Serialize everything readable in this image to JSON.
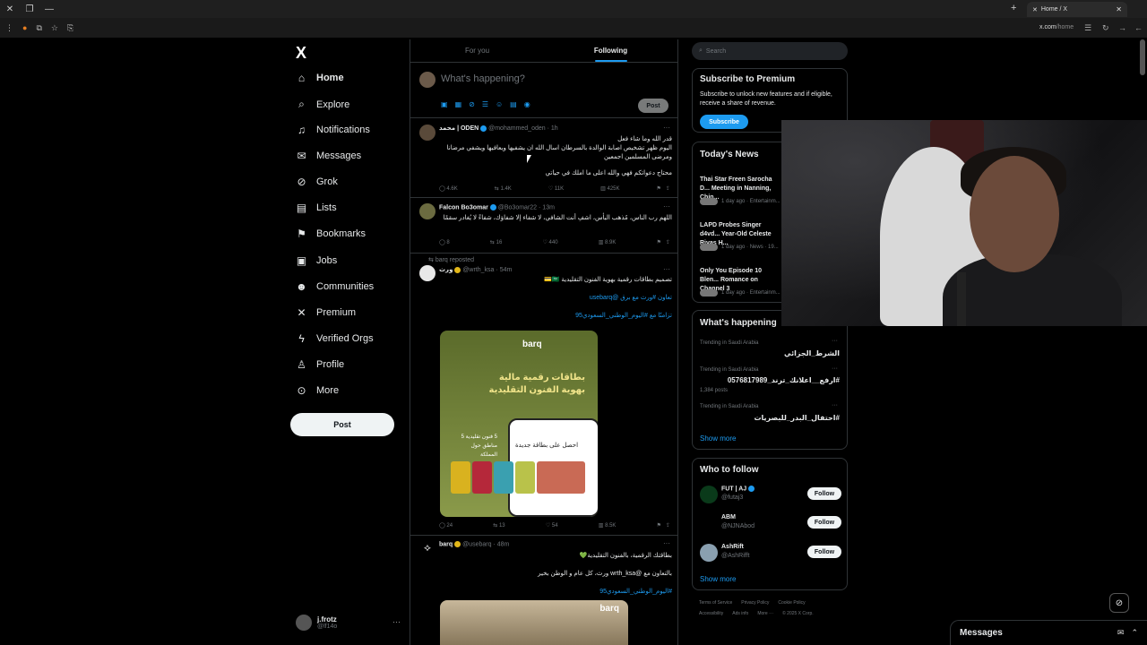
{
  "browser": {
    "tab_title": "Home / X",
    "url_domain": "x.com",
    "url_path": "/home"
  },
  "nav": {
    "logo": "X",
    "items": [
      {
        "label": "Home",
        "icon": "home-icon",
        "glyph": "⌂"
      },
      {
        "label": "Explore",
        "icon": "search-icon",
        "glyph": "⌕"
      },
      {
        "label": "Notifications",
        "icon": "bell-icon",
        "glyph": "♫"
      },
      {
        "label": "Messages",
        "icon": "mail-icon",
        "glyph": "✉"
      },
      {
        "label": "Grok",
        "icon": "grok-icon",
        "glyph": "⊘"
      },
      {
        "label": "Lists",
        "icon": "list-icon",
        "glyph": "▤"
      },
      {
        "label": "Bookmarks",
        "icon": "bookmark-icon",
        "glyph": "⚑"
      },
      {
        "label": "Jobs",
        "icon": "briefcase-icon",
        "glyph": "▣"
      },
      {
        "label": "Communities",
        "icon": "people-icon",
        "glyph": "☻"
      },
      {
        "label": "Premium",
        "icon": "x-premium-icon",
        "glyph": "✕"
      },
      {
        "label": "Verified Orgs",
        "icon": "lightning-icon",
        "glyph": "ϟ"
      },
      {
        "label": "Profile",
        "icon": "person-icon",
        "glyph": "♙"
      },
      {
        "label": "More",
        "icon": "more-circle-icon",
        "glyph": "⊙"
      }
    ],
    "post_label": "Post",
    "user_name": "j.frotz",
    "user_handle": "@lf14o"
  },
  "feed": {
    "tabs": [
      "For you",
      "Following"
    ],
    "compose_placeholder": "What's happening?",
    "compose_post": "Post",
    "tweets": [
      {
        "name": "محمد | ODEN",
        "handle": "@mohammed_oden",
        "time": "1h",
        "lines": [
          "قدر الله وما شاء فعل",
          "اليوم ظهر تشخيص اصابة الوالدة بالسرطان اسال الله ان يشفيها ويعافيها ويشفي مرضانا ومرضى المسلمين اجمعين",
          "محتاج دعواتكم فهي والله اعلى ما املك في حياتي"
        ],
        "replies": "4.6K",
        "reposts": "1.4K",
        "likes": "11K",
        "views": "425K"
      },
      {
        "name": "Falcon Bo3omar",
        "handle": "@Bo3omar22",
        "time": "13m",
        "lines": [
          "اللهم رب الناس، مُذهب البأس، اشفِ أنت الشافي، لا شفاء إلا شفاؤك، شفاءً لا يُغادر سقمًا"
        ],
        "replies": "8",
        "reposts": "16",
        "likes": "440",
        "views": "8.9K"
      },
      {
        "reposted_by": "barq reposted",
        "name": "ورث",
        "handle": "@wrth_ksa",
        "time": "54m",
        "lines": [
          "تصميم بطاقات رقمية بهوية الفنون التقليدية 🇸🇦💳",
          "تعاون #ورث مع برق @usebarq",
          "تزامنًا مع #اليوم_الوطني_السعودي95"
        ],
        "card_brand": "barq",
        "card_title": "بطاقات رقمية مالية بهوية الفنون التقليدية",
        "card_phone": "احصل على بطاقة جديدة",
        "card_side": "5 فنون تقليدية 5 مناطق حول المملكة",
        "replies": "24",
        "reposts": "13",
        "likes": "54",
        "views": "8.5K"
      },
      {
        "name": "barq",
        "handle": "@usebarq",
        "time": "48m",
        "lines": [
          "بطاقتك الرقمية، بالفنون التقليدية💚",
          "بالتعاون مع @wrth_ksa ورث، كل عام و الوطن بخير",
          "#اليوم_الوطني_السعودي95"
        ],
        "card_brand": "barq"
      }
    ]
  },
  "sidebar": {
    "search_placeholder": "Search",
    "premium_title": "Subscribe to Premium",
    "premium_text": "Subscribe to unlock new features and if eligible, receive a share of revenue.",
    "premium_button": "Subscribe",
    "news_title": "Today's News",
    "news": [
      {
        "title": "Thai Star Freen Sarocha D... Meeting in Nanning, Chin...",
        "meta": "1 day ago · Entertainm..."
      },
      {
        "title": "LAPD Probes Singer d4vd... Year-Old Celeste Rivas H...",
        "meta": "1 day ago · News · 19..."
      },
      {
        "title": "Only You Episode 10 Blen... Romance on Channel 3",
        "meta": "1 day ago · Entertainm..."
      }
    ],
    "trending_title": "What's happening",
    "trends": [
      {
        "category": "Trending in Saudi Arabia",
        "name": "الشرط_الجزائي",
        "posts": ""
      },
      {
        "category": "Trending in Saudi Arabia",
        "name": "#ارفع__اعلانك_ترند_0576817989",
        "posts": "1,384 posts"
      },
      {
        "category": "Trending in Saudi Arabia",
        "name": "#احتفال_البدر_للبصريات",
        "posts": ""
      }
    ],
    "show_more": "Show more",
    "wtf_title": "Who to follow",
    "wtf": [
      {
        "name": "FUT | AJ",
        "handle": "@futaj3",
        "button": "Follow"
      },
      {
        "name": "ABM",
        "handle": "@NJNAbod",
        "button": "Follow"
      },
      {
        "name": "AshRift",
        "handle": "@AshRifft",
        "button": "Follow"
      }
    ],
    "wtf_show_more": "Show more",
    "footer": [
      "Terms of Service",
      "Privacy Policy",
      "Cookie Policy",
      "Accessibility",
      "Ads info",
      "More ···",
      "© 2025 X Corp."
    ]
  },
  "messages_drawer": {
    "title": "Messages"
  },
  "colors": {
    "accent": "#1d9bf0",
    "bg": "#000000",
    "border": "#2f3336",
    "muted": "#71767b"
  }
}
